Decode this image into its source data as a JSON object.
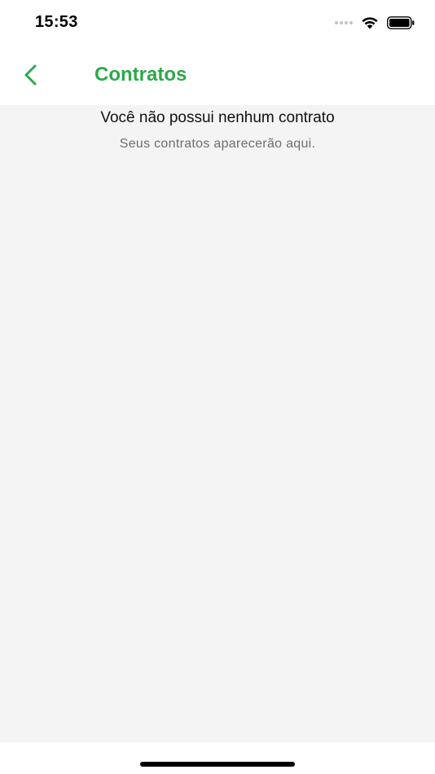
{
  "status_bar": {
    "time": "15:53",
    "icons": [
      "signal-icon",
      "wifi-icon",
      "battery-icon"
    ]
  },
  "header": {
    "back_icon": "chevron-left-icon",
    "title": "Contratos"
  },
  "empty_state": {
    "title": "Você não possui nenhum contrato",
    "subtitle": "Seus contratos aparecerão aqui."
  },
  "colors": {
    "accent": "#2ea84a",
    "background": "#f4f4f4",
    "title_text": "#111111",
    "subtitle_text": "#6e6e6e"
  }
}
